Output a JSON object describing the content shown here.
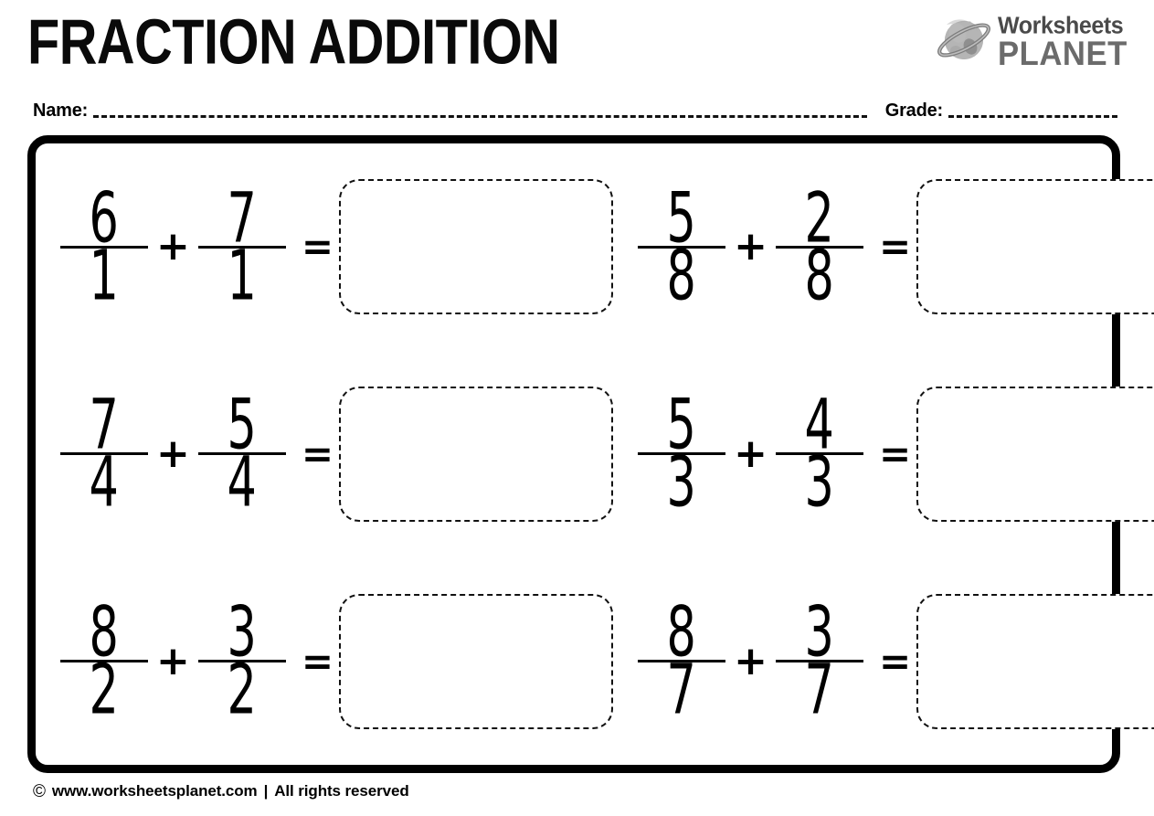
{
  "header": {
    "title": "FRACTION ADDITION",
    "logo": {
      "icon": "saturn-planet-icon",
      "line1": "Worksheets",
      "line2": "PLANET"
    }
  },
  "info": {
    "name_label": "Name:",
    "name_value": "",
    "grade_label": "Grade:",
    "grade_value": ""
  },
  "worksheet": {
    "operator_plus": "+",
    "operator_equals": "=",
    "answer_placeholder": "",
    "problems": [
      {
        "id": 1,
        "a_num": "6",
        "a_den": "1",
        "b_num": "7",
        "b_den": "1",
        "answer": ""
      },
      {
        "id": 2,
        "a_num": "5",
        "a_den": "8",
        "b_num": "2",
        "b_den": "8",
        "answer": ""
      },
      {
        "id": 3,
        "a_num": "7",
        "a_den": "4",
        "b_num": "5",
        "b_den": "4",
        "answer": ""
      },
      {
        "id": 4,
        "a_num": "5",
        "a_den": "3",
        "b_num": "4",
        "b_den": "3",
        "answer": ""
      },
      {
        "id": 5,
        "a_num": "8",
        "a_den": "2",
        "b_num": "3",
        "b_den": "2",
        "answer": ""
      },
      {
        "id": 6,
        "a_num": "8",
        "a_den": "7",
        "b_num": "3",
        "b_den": "7",
        "answer": ""
      }
    ]
  },
  "footer": {
    "copyright_symbol": "©",
    "site": "www.worksheetsplanet.com",
    "separator": "|",
    "rights": "All rights reserved"
  },
  "colors": {
    "ink": "#000000",
    "paper": "#ffffff",
    "logo_gray_light": "#a8a8a8",
    "logo_gray_dark": "#6b6b6b",
    "logo_text_dark": "#4a4a4a"
  }
}
